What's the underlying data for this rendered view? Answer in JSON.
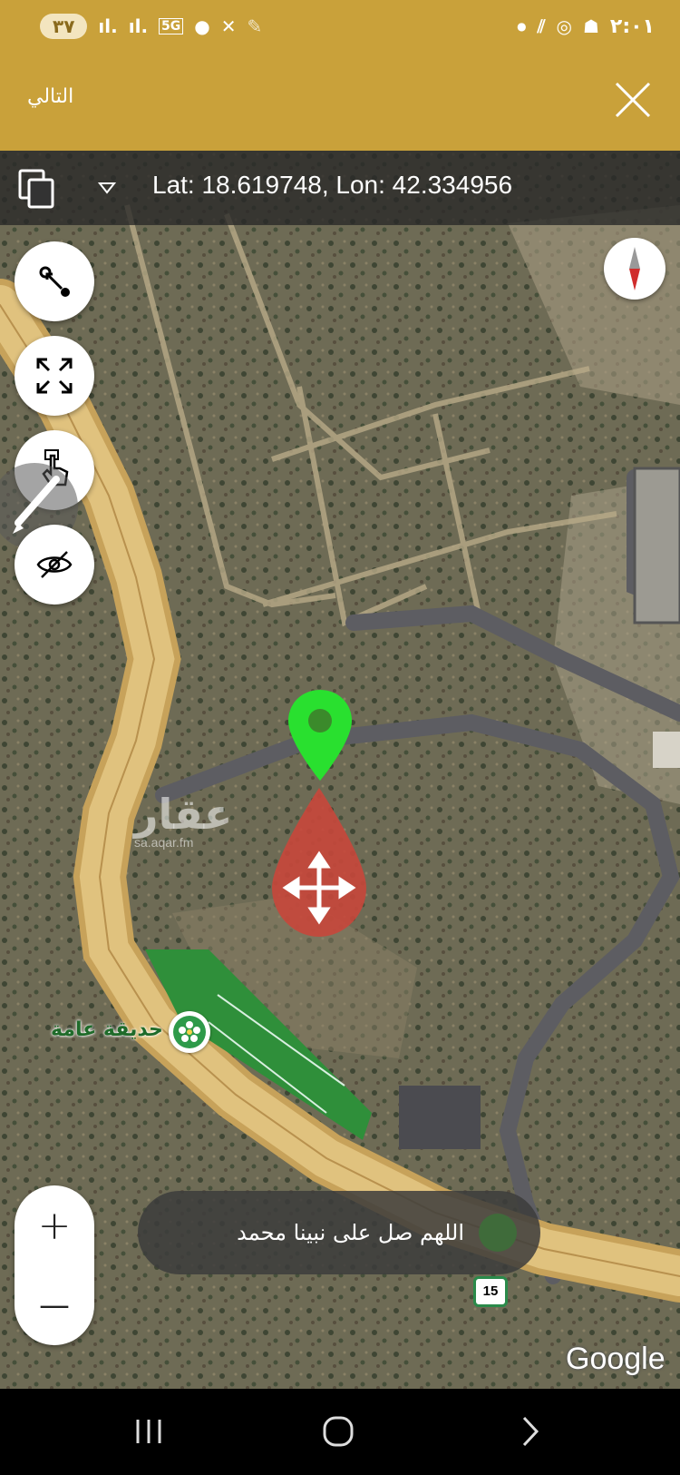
{
  "status_bar": {
    "battery": "٣٧",
    "time": "٢:٠١",
    "network": "5G"
  },
  "header": {
    "next_label": "التالي",
    "close_icon": "close-icon"
  },
  "map": {
    "coordinates": "Lat: 18.619748, Lon: 42.334956",
    "watermark_arabic": "عقار",
    "watermark_url": "sa.aqar.fm",
    "park_label": "حديقة عامة",
    "route_number": "15",
    "attribution": "Google"
  },
  "controls": {
    "zoom_in": "+",
    "zoom_out": "—"
  },
  "toast": {
    "text": "اللهم صل على نبينا محمد"
  },
  "colors": {
    "brand": "#c9a13a",
    "pin_green": "#22dd22",
    "drop_red": "#c8473b",
    "road_yellow": "#d8b668"
  }
}
